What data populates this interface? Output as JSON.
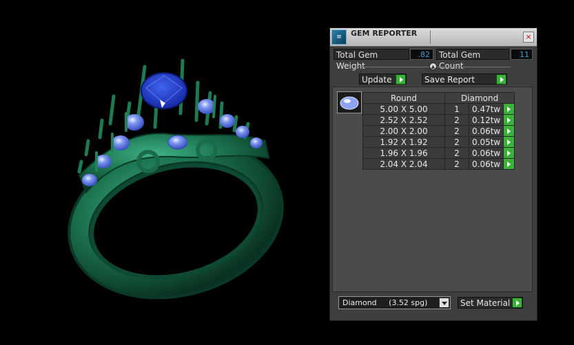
{
  "panel": {
    "title": "GEM REPORTER",
    "total_weight_label": "Total Gem Weight",
    "total_weight_value": ".82",
    "total_count_label": "Total Gem Count",
    "total_count_value": "11",
    "update_label": "Update",
    "save_report_label": "Save Report",
    "table": {
      "headers": [
        "Round",
        "Diamond"
      ],
      "rows": [
        {
          "size": "5.00 X 5.00",
          "qty": "1",
          "weight": "0.47tw"
        },
        {
          "size": "2.52 X 2.52",
          "qty": "2",
          "weight": "0.12tw"
        },
        {
          "size": "2.00 X 2.00",
          "qty": "2",
          "weight": "0.06tw"
        },
        {
          "size": "1.92 X 1.92",
          "qty": "2",
          "weight": "0.05tw"
        },
        {
          "size": "1.96 X 1.96",
          "qty": "2",
          "weight": "0.06tw"
        },
        {
          "size": "2.04 X 2.04",
          "qty": "2",
          "weight": "0.06tw"
        }
      ]
    },
    "material_select": {
      "selected": "Diamond     (3.52 spg)"
    },
    "set_material_label": "Set Material"
  },
  "colors": {
    "ring_metal": "#1f7a55",
    "gem": "#4a6fe0",
    "center_gem": "#1e3fd0",
    "accent_go": "#3ab23a",
    "value_text": "#36a4d6"
  },
  "icons": {
    "app": "gem-reporter-icon",
    "close": "close-icon",
    "go": "play-arrow-icon",
    "dropdown": "chevron-down-icon"
  }
}
